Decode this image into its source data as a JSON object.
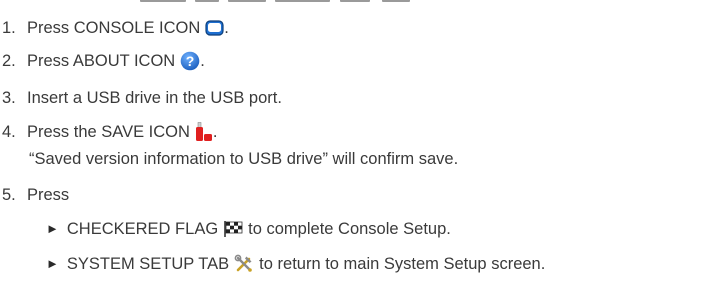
{
  "steps": [
    {
      "number": "1.",
      "text": "Press CONSOLE ICON",
      "suffix": ".",
      "icon": "console-icon"
    },
    {
      "number": "2.",
      "text": "Press ABOUT ICON",
      "suffix": ".",
      "icon": "about-icon"
    },
    {
      "number": "3.",
      "text": "Insert a USB drive in the USB port."
    },
    {
      "number": "4.",
      "text": "Press the SAVE ICON",
      "suffix": ".",
      "icon": "save-icon",
      "note": "“Saved version information to USB drive” will confirm save."
    },
    {
      "number": "5.",
      "text": "Press",
      "options": [
        {
          "lead": "CHECKERED FLAG",
          "tail": "to complete Console Setup.",
          "icon": "checkered-flag-icon"
        },
        {
          "lead": "SYSTEM SETUP TAB",
          "tail": "to return to main System Setup screen.",
          "icon": "system-setup-tab-icon"
        }
      ]
    }
  ],
  "bullet_glyph": "►",
  "colors": {
    "text": "#3a3a3a",
    "console_icon": "#1e6fd0",
    "about_icon": "#2d7de0",
    "save_icon": "#e02020"
  }
}
